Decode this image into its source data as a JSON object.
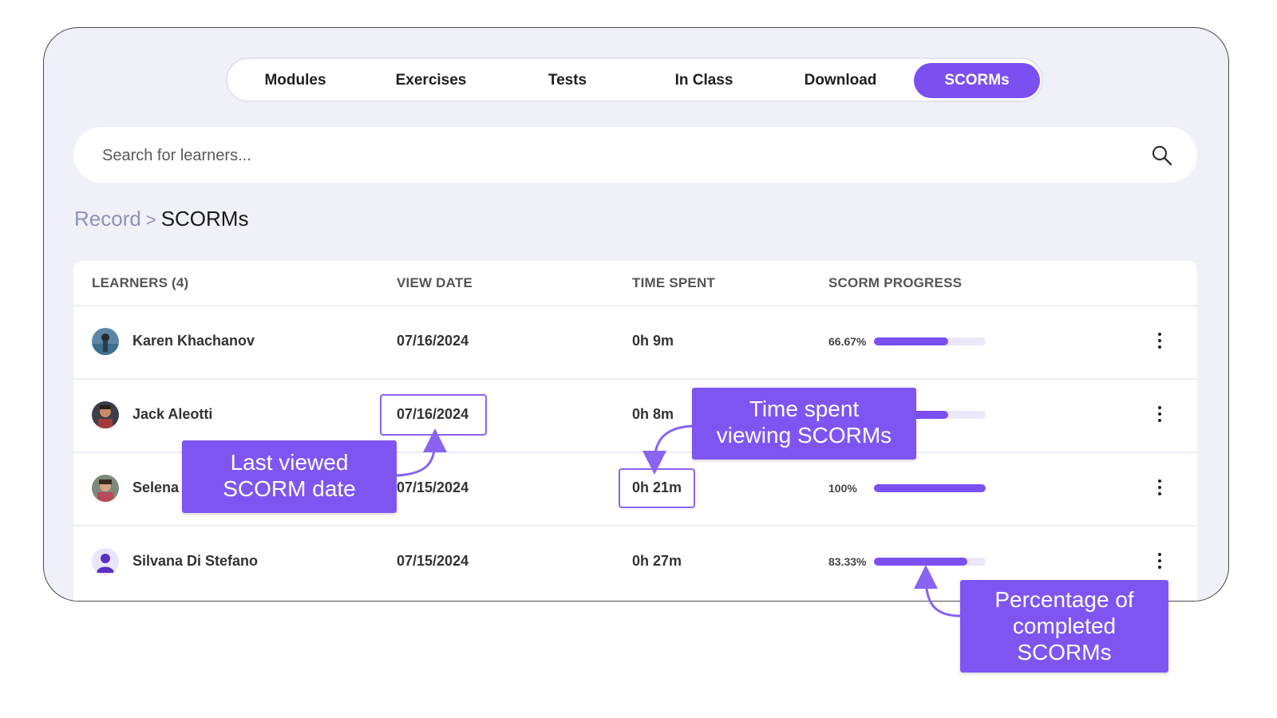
{
  "tabs": [
    {
      "label": "Modules",
      "active": false
    },
    {
      "label": "Exercises",
      "active": false
    },
    {
      "label": "Tests",
      "active": false
    },
    {
      "label": "In Class",
      "active": false
    },
    {
      "label": "Download",
      "active": false
    },
    {
      "label": "SCORMs",
      "active": true
    }
  ],
  "search": {
    "placeholder": "Search for learners..."
  },
  "breadcrumb": {
    "root": "Record",
    "separator": ">",
    "current": "SCORMs"
  },
  "table": {
    "headers": {
      "learners": "LEARNERS (4)",
      "view_date": "VIEW DATE",
      "time_spent": "TIME SPENT",
      "progress": "SCORM PROGRESS"
    },
    "rows": [
      {
        "name": "Karen Khachanov",
        "view_date": "07/16/2024",
        "time_spent": "0h 9m",
        "progress_label": "66.67%",
        "progress": 0.6667
      },
      {
        "name": "Jack Aleotti",
        "view_date": "07/16/2024",
        "time_spent": "0h 8m",
        "progress_label": "",
        "progress": 0.6667
      },
      {
        "name": "Selena",
        "view_date": "07/15/2024",
        "time_spent": "0h 21m",
        "progress_label": "100%",
        "progress": 1.0
      },
      {
        "name": "Silvana Di Stefano",
        "view_date": "07/15/2024",
        "time_spent": "0h 27m",
        "progress_label": "83.33%",
        "progress": 0.8333
      }
    ]
  },
  "callouts": {
    "last_viewed": [
      "Last viewed",
      "SCORM date"
    ],
    "time_spent": [
      "Time spent",
      "viewing SCORMs"
    ],
    "percentage": [
      "Percentage of",
      "completed",
      "SCORMs"
    ]
  },
  "colors": {
    "accent": "#7b4ff0",
    "callout": "#7f55f2",
    "frame_bg": "#eff0f8"
  },
  "icons": {
    "search": "search-icon",
    "row_menu": "kebab-menu-icon",
    "avatar_placeholder": "user-icon"
  }
}
